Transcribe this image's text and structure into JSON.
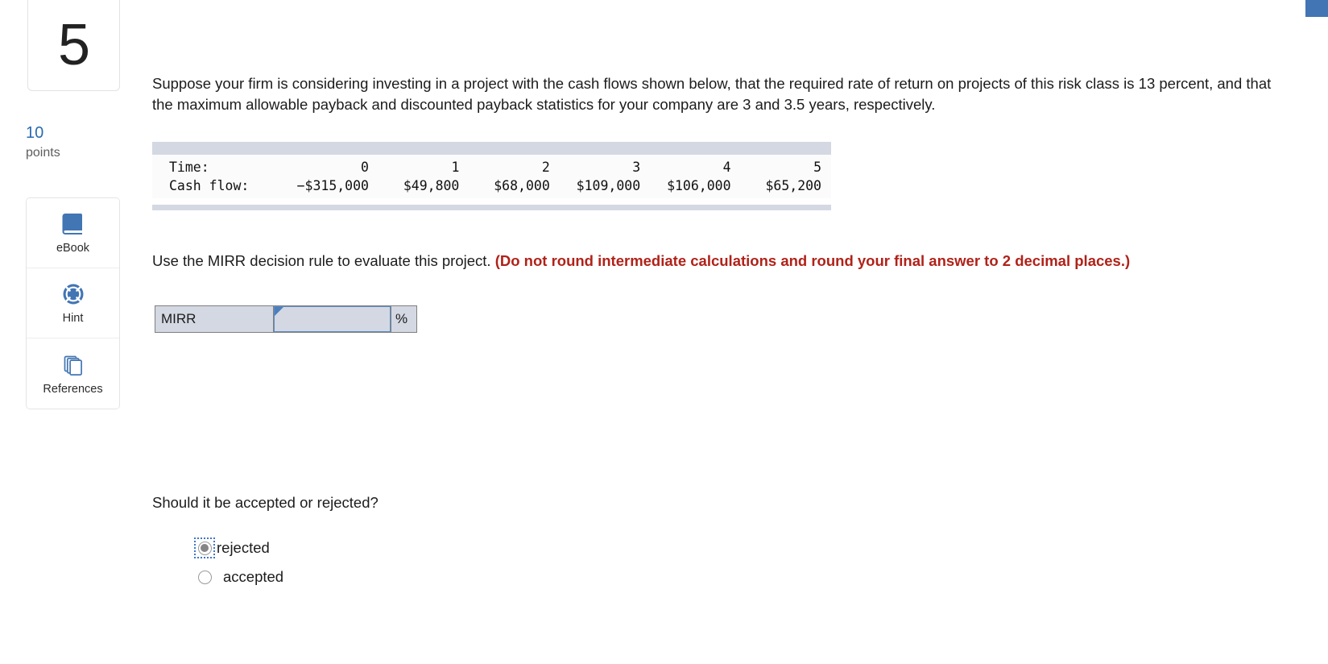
{
  "question": {
    "number": "5",
    "points_value": "10",
    "points_label": "points",
    "stem": "Suppose your firm is considering investing in a project with the cash flows shown below, that the required rate of return on projects of this risk class is 13 percent, and that the maximum allowable payback and discounted payback statistics for your company are 3 and 3.5 years, respectively.",
    "instruction_plain": "Use the MIRR decision rule to evaluate this project. ",
    "instruction_emphasis": "(Do not round intermediate calculations and round your final answer to 2 decimal places.)",
    "followup": "Should it be accepted or rejected?"
  },
  "tools": [
    {
      "label": "eBook",
      "icon": "ebook-icon"
    },
    {
      "label": "Hint",
      "icon": "lifering-icon"
    },
    {
      "label": "References",
      "icon": "references-icon"
    }
  ],
  "cash_flow_table": {
    "row_headers": [
      "Time:",
      "Cash flow:"
    ],
    "time": [
      "0",
      "1",
      "2",
      "3",
      "4",
      "5"
    ],
    "cash_flow": [
      "−$315,000",
      "$49,800",
      "$68,000",
      "$109,000",
      "$106,000",
      "$65,200"
    ]
  },
  "answer": {
    "label": "MIRR",
    "value": "",
    "placeholder": "",
    "unit": "%"
  },
  "choices": [
    {
      "label": "rejected",
      "checked": true,
      "focused": true
    },
    {
      "label": "accepted",
      "checked": false,
      "focused": false
    }
  ],
  "colors": {
    "accent_blue": "#4175b4",
    "points_blue": "#2a6bb0",
    "emphasis_red": "#b02219",
    "table_bar": "#d3d8e2",
    "field_fill": "#d3d8e2",
    "field_border_blue": "#5b8cc8"
  }
}
